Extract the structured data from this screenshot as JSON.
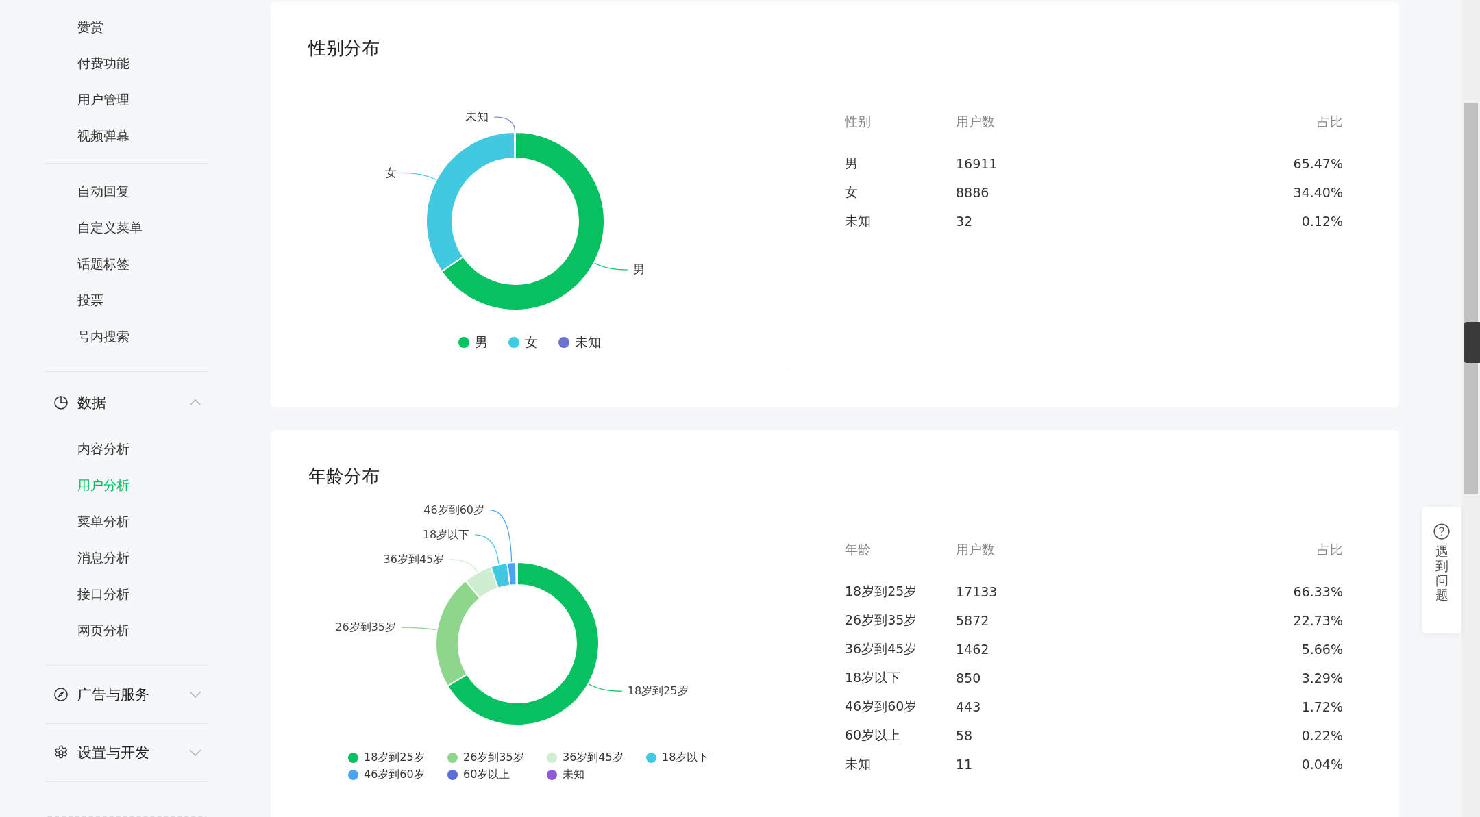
{
  "sidebar": {
    "sections": [
      {
        "items": [
          {
            "label": "赞赏",
            "selected": false
          },
          {
            "label": "付费功能",
            "selected": false
          },
          {
            "label": "用户管理",
            "selected": false
          },
          {
            "label": "视频弹幕",
            "selected": false
          }
        ]
      },
      {
        "items": [
          {
            "label": "自动回复",
            "selected": false
          },
          {
            "label": "自定义菜单",
            "selected": false
          },
          {
            "label": "话题标签",
            "selected": false
          },
          {
            "label": "投票",
            "selected": false
          },
          {
            "label": "号内搜索",
            "selected": false
          }
        ]
      }
    ],
    "groups": [
      {
        "title": "数据",
        "kind": "pie",
        "expanded": true,
        "items": [
          {
            "label": "内容分析",
            "selected": false
          },
          {
            "label": "用户分析",
            "selected": true
          },
          {
            "label": "菜单分析",
            "selected": false
          },
          {
            "label": "消息分析",
            "selected": false
          },
          {
            "label": "接口分析",
            "selected": false
          },
          {
            "label": "网页分析",
            "selected": false
          }
        ]
      },
      {
        "title": "广告与服务",
        "kind": "compass",
        "expanded": false
      },
      {
        "title": "设置与开发",
        "kind": "gear",
        "expanded": false
      }
    ]
  },
  "cards": [
    {
      "title": "性别分布",
      "callouts": [
        {
          "label": "未知",
          "color": "#6a72d0"
        },
        {
          "label": "女",
          "color": "#40c9e0"
        },
        {
          "label": "男",
          "color": "#07c160"
        }
      ],
      "legend": [
        {
          "label": "男",
          "color": "#07c160"
        },
        {
          "label": "女",
          "color": "#40c9e0"
        },
        {
          "label": "未知",
          "color": "#6a72d0"
        }
      ],
      "table": {
        "columns": [
          "性别",
          "用户数",
          "占比"
        ],
        "rows": [
          [
            "男",
            "16911",
            "65.47%"
          ],
          [
            "女",
            "8886",
            "34.40%"
          ],
          [
            "未知",
            "32",
            "0.12%"
          ]
        ]
      }
    },
    {
      "title": "年龄分布",
      "callouts": [
        {
          "label": "46岁到60岁",
          "color": "#4aa3f0"
        },
        {
          "label": "18岁以下",
          "color": "#40c9e0"
        },
        {
          "label": "36岁到45岁",
          "color": "#cdeed0"
        },
        {
          "label": "26岁到35岁",
          "color": "#8ed68b"
        },
        {
          "label": "18岁到25岁",
          "color": "#07c160"
        }
      ],
      "legend": [
        {
          "label": "18岁到25岁",
          "color": "#07c160"
        },
        {
          "label": "26岁到35岁",
          "color": "#8ed68b"
        },
        {
          "label": "36岁到45岁",
          "color": "#cdeed0"
        },
        {
          "label": "18岁以下",
          "color": "#40c9e0"
        },
        {
          "label": "46岁到60岁",
          "color": "#4aa3f0"
        },
        {
          "label": "60岁以上",
          "color": "#5b6fd6"
        },
        {
          "label": "未知",
          "color": "#8e5bd6"
        }
      ],
      "table": {
        "columns": [
          "年龄",
          "用户数",
          "占比"
        ],
        "rows": [
          [
            "18岁到25岁",
            "17133",
            "66.33%"
          ],
          [
            "26岁到35岁",
            "5872",
            "22.73%"
          ],
          [
            "36岁到45岁",
            "1462",
            "5.66%"
          ],
          [
            "18岁以下",
            "850",
            "3.29%"
          ],
          [
            "46岁到60岁",
            "443",
            "1.72%"
          ],
          [
            "60岁以上",
            "58",
            "0.22%"
          ],
          [
            "未知",
            "11",
            "0.04%"
          ]
        ]
      }
    }
  ],
  "help": {
    "label": "遇到问题"
  }
}
